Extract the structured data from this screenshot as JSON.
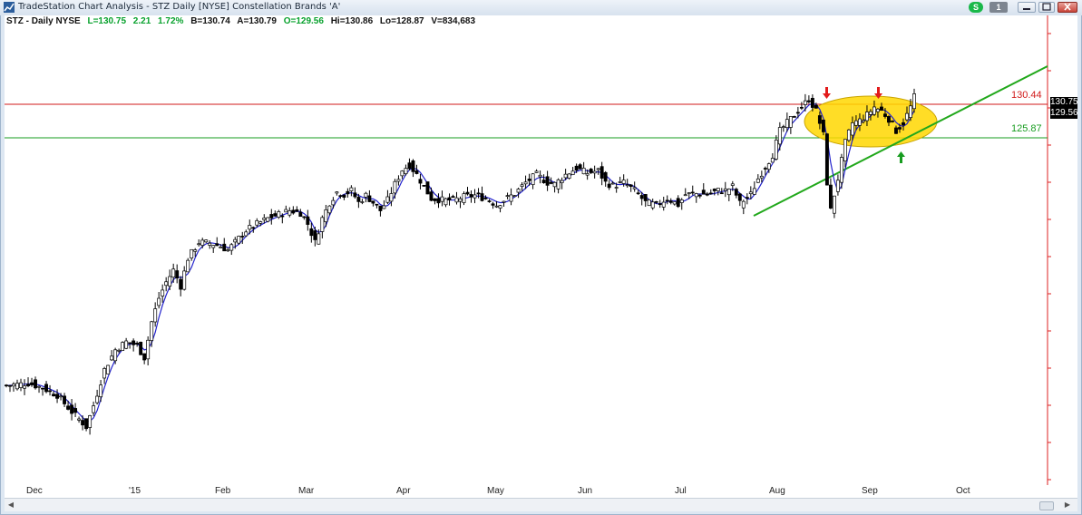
{
  "window": {
    "title": "TradeStation Chart Analysis - STZ Daily [NYSE] Constellation Brands 'A'",
    "status_button_label": "S",
    "window_count_label": "1"
  },
  "header": {
    "symbol": "STZ - Daily  NYSE",
    "last": "L=130.75",
    "change": "2.21",
    "change_pct": "1.72%",
    "bid": "B=130.74",
    "ask": "A=130.79",
    "open": "O=129.56",
    "high": "Hi=130.86",
    "low": "Lo=128.87",
    "volume": "V=834,683"
  },
  "levels": {
    "resistance_label": "130.44",
    "support_label": "125.87",
    "last_price": "130.75",
    "open_price": "129.56"
  },
  "colors": {
    "resistance": "#d11a1a",
    "support": "#179c1f",
    "highlight": "#ffd700",
    "up_arrow": "#179c1f",
    "down_arrow": "#e21b1b",
    "moving_average": "#2222cc"
  },
  "time_axis": {
    "labels": [
      "Dec",
      "'15",
      "Feb",
      "Mar",
      "Apr",
      "May",
      "Jun",
      "Jul",
      "Aug",
      "Sep",
      "Oct"
    ]
  },
  "chart_data": {
    "type": "candlestick",
    "symbol": "STZ",
    "interval": "Daily",
    "y_range": [
      82,
      141
    ],
    "horizontal_levels": [
      130.44,
      125.87
    ],
    "anchors": [
      [
        0,
        94.5
      ],
      [
        6,
        94.8
      ],
      [
        10,
        94.2
      ],
      [
        14,
        93.3
      ],
      [
        18,
        91.2
      ],
      [
        21,
        89.8
      ],
      [
        22,
        89.3
      ],
      [
        24,
        92.0
      ],
      [
        27,
        96.5
      ],
      [
        30,
        99.0
      ],
      [
        33,
        100.0
      ],
      [
        36,
        99.5
      ],
      [
        38,
        98.0
      ],
      [
        40,
        102.5
      ],
      [
        42,
        105.5
      ],
      [
        44,
        107.5
      ],
      [
        46,
        109.0
      ],
      [
        48,
        107.0
      ],
      [
        50,
        110.5
      ],
      [
        53,
        112.5
      ],
      [
        56,
        112.4
      ],
      [
        59,
        112.0
      ],
      [
        61,
        111.5
      ],
      [
        64,
        113.0
      ],
      [
        66,
        114.0
      ],
      [
        69,
        114.8
      ],
      [
        72,
        115.5
      ],
      [
        75,
        116.0
      ],
      [
        78,
        116.5
      ],
      [
        81,
        116.2
      ],
      [
        83,
        114.8
      ],
      [
        85,
        112.5
      ],
      [
        87,
        115.5
      ],
      [
        89,
        117.5
      ],
      [
        91,
        118.8
      ],
      [
        93,
        118.5
      ],
      [
        95,
        119.0
      ],
      [
        97,
        117.5
      ],
      [
        99,
        118.4
      ],
      [
        101,
        117.5
      ],
      [
        103,
        116.5
      ],
      [
        105,
        117.8
      ],
      [
        107,
        119.8
      ],
      [
        109,
        121.6
      ],
      [
        111,
        122.2
      ],
      [
        113,
        121.0
      ],
      [
        115,
        119.5
      ],
      [
        117,
        118.0
      ],
      [
        120,
        117.8
      ],
      [
        123,
        117.8
      ],
      [
        126,
        118.2
      ],
      [
        129,
        118.4
      ],
      [
        132,
        118.0
      ],
      [
        135,
        117.2
      ],
      [
        137,
        117.8
      ],
      [
        140,
        118.6
      ],
      [
        143,
        120.0
      ],
      [
        146,
        121.0
      ],
      [
        149,
        120.0
      ],
      [
        151,
        119.8
      ],
      [
        154,
        121.0
      ],
      [
        157,
        121.8
      ],
      [
        160,
        121.2
      ],
      [
        163,
        121.5
      ],
      [
        165,
        120.0
      ],
      [
        167,
        119.6
      ],
      [
        170,
        120.0
      ],
      [
        173,
        119.0
      ],
      [
        176,
        117.5
      ],
      [
        179,
        117.2
      ],
      [
        182,
        118.0
      ],
      [
        185,
        117.2
      ],
      [
        187,
        118.5
      ],
      [
        190,
        118.6
      ],
      [
        193,
        118.5
      ],
      [
        196,
        119.0
      ],
      [
        198,
        119.0
      ],
      [
        200,
        119.5
      ],
      [
        202,
        117.4
      ],
      [
        205,
        118.5
      ],
      [
        207,
        120.5
      ],
      [
        209,
        122.0
      ],
      [
        211,
        123.5
      ],
      [
        213,
        126.5
      ],
      [
        215,
        127.5
      ],
      [
        217,
        128.5
      ],
      [
        219,
        129.5
      ],
      [
        221,
        130.5
      ],
      [
        223,
        129.0
      ],
      [
        225,
        126.0
      ],
      [
        226,
        120.0
      ],
      [
        227,
        116.5
      ],
      [
        229,
        120.5
      ],
      [
        231,
        125.0
      ],
      [
        233,
        127.5
      ],
      [
        235,
        127.8
      ],
      [
        237,
        128.5
      ],
      [
        239,
        129.5
      ],
      [
        241,
        129.0
      ],
      [
        243,
        128.0
      ],
      [
        245,
        126.5
      ],
      [
        247,
        127.5
      ],
      [
        249,
        129.5
      ],
      [
        250,
        130.75
      ]
    ]
  }
}
